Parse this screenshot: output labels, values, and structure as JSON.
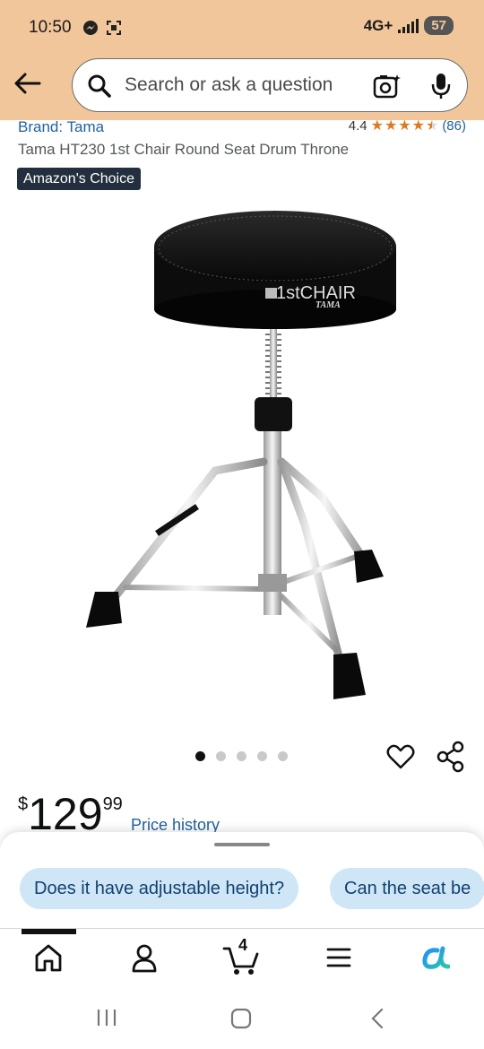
{
  "status": {
    "time": "10:50",
    "network": "4G+",
    "battery": "57"
  },
  "search": {
    "placeholder": "Search or ask a question"
  },
  "product": {
    "brand": "Brand: Tama",
    "rating": "4.4",
    "stars": 4.4,
    "review_count": "(86)",
    "title": "Tama HT230 1st Chair Round Seat Drum Throne",
    "badge": "Amazon's Choice",
    "image_text_brand": "1stCHAIR",
    "image_text_logo": "TAMA",
    "image_count": 5,
    "active_image": 1,
    "price_symbol": "$",
    "price_whole": "129",
    "price_fraction": "99",
    "price_history": "Price history"
  },
  "sheet": {
    "chips": [
      "Does it have adjustable height?",
      "Can the seat be"
    ]
  },
  "nav": {
    "cart_count": "4",
    "items": [
      "home-icon",
      "account-icon",
      "cart-icon",
      "menu-icon",
      "rufus-icon"
    ]
  },
  "colors": {
    "header": "#f2c69b",
    "link": "#2162a1",
    "star": "#de7921",
    "badge": "#232f3e",
    "chip": "#cfe6f7"
  }
}
